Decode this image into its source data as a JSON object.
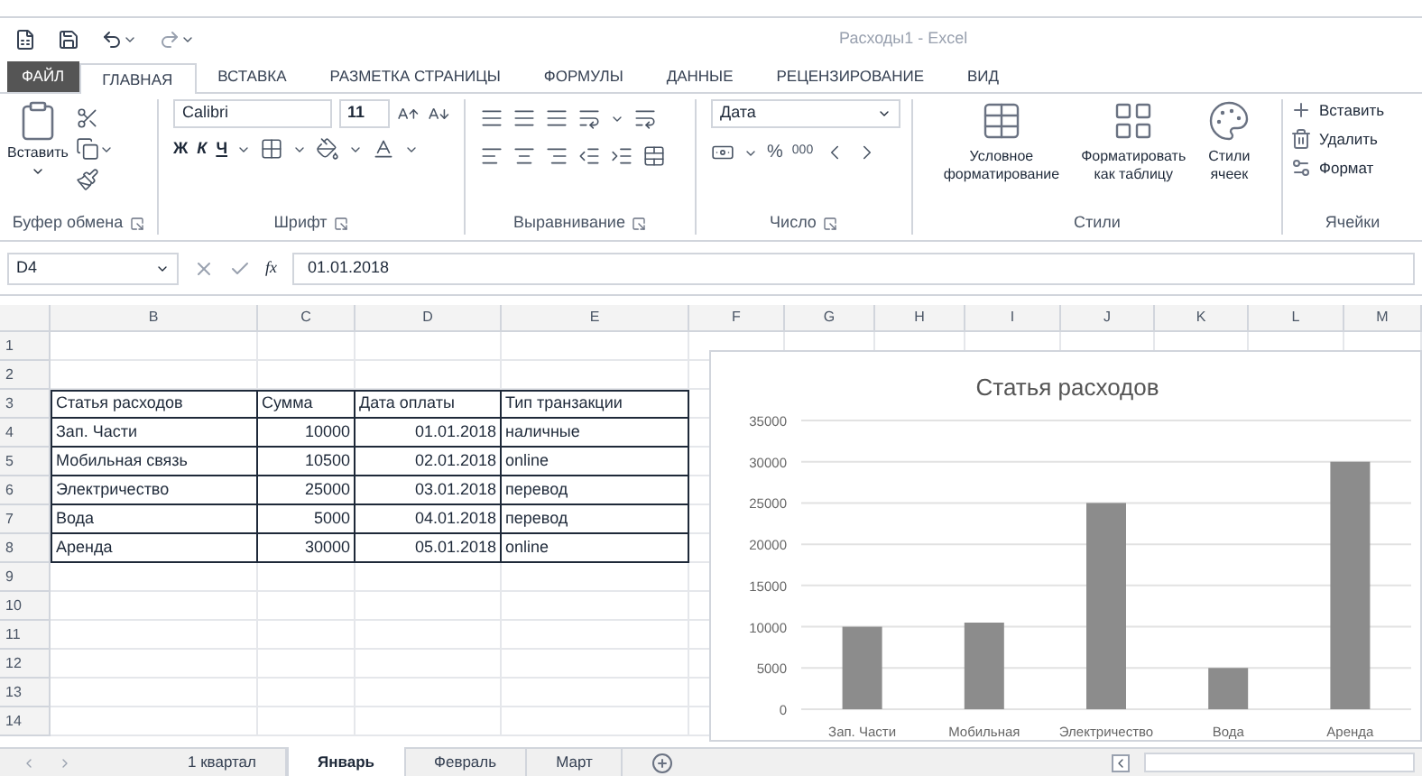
{
  "window": {
    "title": "Расходы1 - Excel"
  },
  "ribbon_tabs": [
    {
      "label": "ФАЙЛ",
      "kind": "file",
      "selected": false
    },
    {
      "label": "ГЛАВНАЯ",
      "kind": "tab",
      "selected": true
    },
    {
      "label": "ВСТАВКА",
      "kind": "tab",
      "selected": false
    },
    {
      "label": "РАЗМЕТКА СТРАНИЦЫ",
      "kind": "tab",
      "selected": false
    },
    {
      "label": "ФОРМУЛЫ",
      "kind": "tab",
      "selected": false
    },
    {
      "label": "ДАННЫЕ",
      "kind": "tab",
      "selected": false
    },
    {
      "label": "РЕЦЕНЗИРОВАНИЕ",
      "kind": "tab",
      "selected": false
    },
    {
      "label": "ВИД",
      "kind": "tab",
      "selected": false
    }
  ],
  "ribbon": {
    "clipboard": {
      "paste": "Вставить",
      "label": "Буфер обмена"
    },
    "font": {
      "font_name": "Calibri",
      "font_size": "11",
      "bold": "Ж",
      "italic": "К",
      "underline": "Ч",
      "label": "Шрифт"
    },
    "alignment": {
      "label": "Выравнивание"
    },
    "number": {
      "format": "Дата",
      "percent": "%",
      "thousands": "000",
      "label": "Число"
    },
    "styles": {
      "buttons": [
        {
          "line1": "Условное",
          "line2": "форматирование"
        },
        {
          "line1": "Форматировать",
          "line2": "как таблицу"
        },
        {
          "line1": "Стили",
          "line2": "ячеек"
        }
      ],
      "label": "Стили"
    },
    "cells": {
      "buttons": [
        "Вставить",
        "Удалить",
        "Формат"
      ],
      "label": "Ячейки"
    }
  },
  "formula_bar": {
    "name_box": "D4",
    "fx": "fx",
    "value": "01.01.2018"
  },
  "sheet": {
    "columns": [
      "B",
      "C",
      "D",
      "E",
      "F",
      "G",
      "H",
      "I",
      "J",
      "K",
      "L",
      "M"
    ],
    "rows": [
      {
        "number": "1",
        "kind": "empty",
        "cells": []
      },
      {
        "number": "2",
        "kind": "empty",
        "cells": []
      },
      {
        "number": "3",
        "kind": "header",
        "cells": [
          "Статья расходов",
          "Сумма",
          "Дата оплаты",
          "Тип транзакции"
        ]
      },
      {
        "number": "4",
        "kind": "data",
        "cells": [
          "Зап. Части",
          "10000",
          "01.01.2018",
          "наличные"
        ]
      },
      {
        "number": "5",
        "kind": "data",
        "cells": [
          "Мобильная связь",
          "10500",
          "02.01.2018",
          "online"
        ]
      },
      {
        "number": "6",
        "kind": "data",
        "cells": [
          "Электричество",
          "25000",
          "03.01.2018",
          "перевод"
        ]
      },
      {
        "number": "7",
        "kind": "data",
        "cells": [
          "Вода",
          "5000",
          "04.01.2018",
          "перевод"
        ]
      },
      {
        "number": "8",
        "kind": "data",
        "cells": [
          "Аренда",
          "30000",
          "05.01.2018",
          "online"
        ]
      },
      {
        "number": "9",
        "kind": "empty",
        "cells": []
      },
      {
        "number": "10",
        "kind": "empty",
        "cells": []
      },
      {
        "number": "11",
        "kind": "empty",
        "cells": []
      },
      {
        "number": "12",
        "kind": "empty",
        "cells": []
      },
      {
        "number": "13",
        "kind": "empty",
        "cells": []
      },
      {
        "number": "14",
        "kind": "empty",
        "cells": []
      }
    ],
    "chart": {
      "chart_data": {
        "type": "bar",
        "title": "Статья расходов",
        "categories": [
          "Зап. Части",
          "Мобильная",
          "Электричество",
          "Вода",
          "Аренда"
        ],
        "series": [
          {
            "color": "#8c8c8c",
            "values": [
              10000,
              10500,
              25000,
              5000,
              30000
            ]
          }
        ],
        "grid": true,
        "ylim": [
          0,
          35000
        ],
        "yticks": [
          0,
          5000,
          10000,
          15000,
          20000,
          25000,
          30000,
          35000
        ]
      }
    }
  },
  "sheet_tabs": [
    {
      "label": "1 квартал",
      "selected": false
    },
    {
      "label": "Январь",
      "selected": true
    },
    {
      "label": "Февраль",
      "selected": false
    },
    {
      "label": "Март",
      "selected": false
    }
  ]
}
